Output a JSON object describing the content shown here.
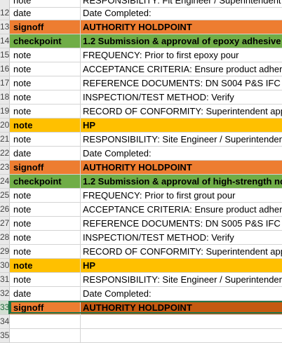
{
  "rows": [
    {
      "num": "",
      "a": "note",
      "b": "RESPONSIBILITY: Fit Engineer / Superintendent"
    },
    {
      "num": "12",
      "a": "date",
      "b": "Date Completed:"
    },
    {
      "num": "13",
      "a": "signoff",
      "b": "AUTHORITY HOLDPOINT"
    },
    {
      "num": "14",
      "a": "checkpoint",
      "b": "1.2 Submission & approval of epoxy adhesive"
    },
    {
      "num": "15",
      "a": "note",
      "b": "FREQUENCY: Prior to first epoxy pour"
    },
    {
      "num": "16",
      "a": "note",
      "b": "ACCEPTANCE CRITERIA: Ensure product adheres"
    },
    {
      "num": "17",
      "a": "note",
      "b": "REFERENCE DOCUMENTS: DN S004 P&S IFC"
    },
    {
      "num": "18",
      "a": "note",
      "b": "INSPECTION/TEST METHOD: Verify"
    },
    {
      "num": "19",
      "a": "note",
      "b": "RECORD OF CONFORMITY: Superintendent appr"
    },
    {
      "num": "20",
      "a": "note",
      "b": "HP"
    },
    {
      "num": "21",
      "a": "note",
      "b": "RESPONSIBILITY: Site Engineer / Superintendent"
    },
    {
      "num": "22",
      "a": "date",
      "b": "Date Completed:"
    },
    {
      "num": "23",
      "a": "signoff",
      "b": "AUTHORITY HOLDPOINT"
    },
    {
      "num": "24",
      "a": "checkpoint",
      "b": "1.2 Submission & approval of high-strength no"
    },
    {
      "num": "25",
      "a": "note",
      "b": "FREQUENCY: Prior to first grout pour"
    },
    {
      "num": "26",
      "a": "note",
      "b": "ACCEPTANCE CRITERIA: Ensure product adheres"
    },
    {
      "num": "27",
      "a": "note",
      "b": "REFERENCE DOCUMENTS: DN S005 P&S IFC"
    },
    {
      "num": "28",
      "a": "note",
      "b": "INSPECTION/TEST METHOD: Verify"
    },
    {
      "num": "29",
      "a": "note",
      "b": "RECORD OF CONFORMITY: Superintendent appr"
    },
    {
      "num": "30",
      "a": "note",
      "b": "HP"
    },
    {
      "num": "31",
      "a": "note",
      "b": "RESPONSIBILITY: Site Engineer / Superintendent"
    },
    {
      "num": "32",
      "a": "date",
      "b": "Date Completed:"
    },
    {
      "num": "33",
      "a": "signoff",
      "b": "AUTHORITY HOLDPOINT"
    },
    {
      "num": "34",
      "a": "",
      "b": ""
    },
    {
      "num": "35",
      "a": "",
      "b": ""
    }
  ],
  "colors": {
    "orange": "#ed7d31",
    "green": "#70ad47",
    "yellow": "#ffc000",
    "dark_orange": "#c55a11",
    "selection": "#217346"
  }
}
